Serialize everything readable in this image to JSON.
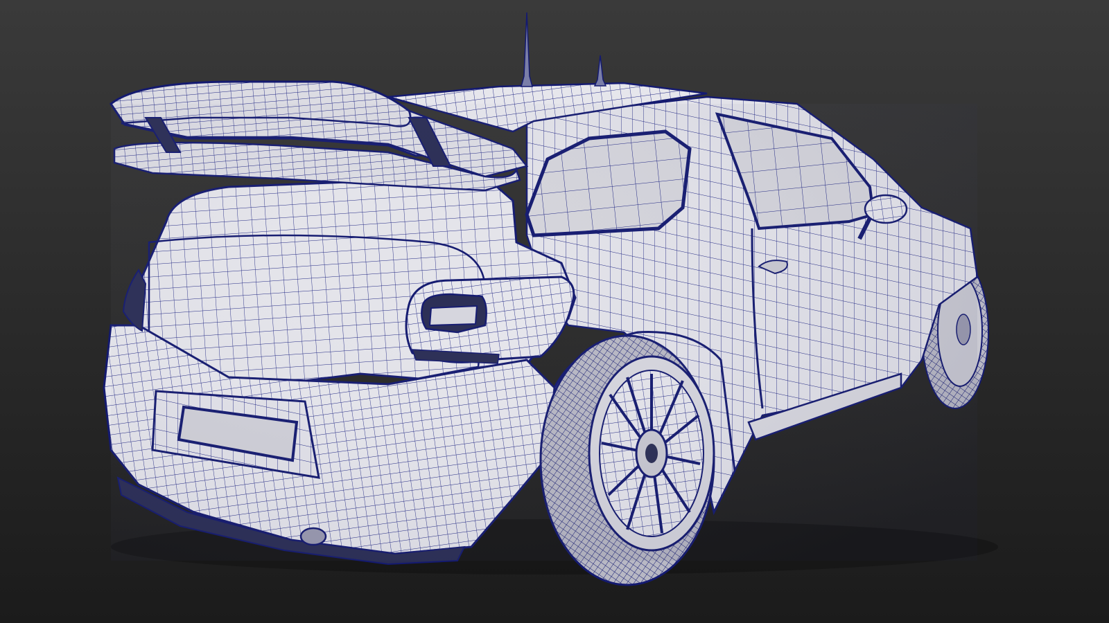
{
  "image": {
    "subject": "wireframe-rally-hatchback-rear-three-quarter",
    "colors": {
      "background_top": "#3a3a3a",
      "background_bottom": "#1c1c1c",
      "surface": "#e6e6ec",
      "surface_shadow": "#b9b9c4",
      "wire": "#141a7a",
      "glass": "#d3d3da",
      "dark_panel": "#2a2d55"
    }
  }
}
